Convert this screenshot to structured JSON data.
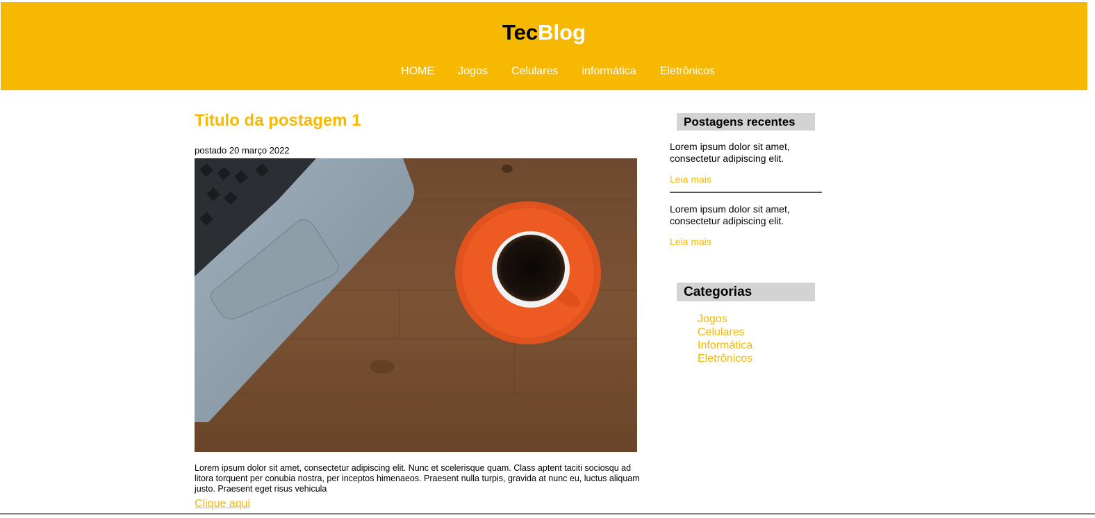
{
  "header": {
    "logo_part1": "Tec",
    "logo_part2": "Blog",
    "nav": [
      "HOME",
      "Jogos",
      "Celulares",
      "informática",
      "Eletrônicos"
    ]
  },
  "post": {
    "title": "Titulo da postagem 1",
    "date": "postado 20 março 2022",
    "text": "Lorem ipsum dolor sit amet, consectetur adipiscing elit. Nunc et scelerisque quam. Class aptent taciti sociosqu ad litora torquent per conubia nostra, per inceptos himenaeos. Praesent nulla turpis, gravida at nunc eu, luctus aliquam justo. Praesent eget risus vehicula",
    "link": "Clique aqui"
  },
  "sidebar": {
    "recent_heading": "Postagens recentes",
    "recent": [
      {
        "text": "Lorem ipsum dolor sit amet, consectetur adipiscing elit.",
        "more": "Leia mais"
      },
      {
        "text": "Lorem ipsum dolor sit amet, consectetur adipiscing elit.",
        "more": "Leia mais"
      }
    ],
    "categories_heading": "Categorias",
    "categories": [
      "Jogos",
      "Celulares",
      "Informática",
      "Eletrônicos"
    ]
  },
  "colors": {
    "accent": "#f6b800",
    "header_bg": "#f6b800",
    "sidebar_heading_bg": "#d3d3d3"
  }
}
